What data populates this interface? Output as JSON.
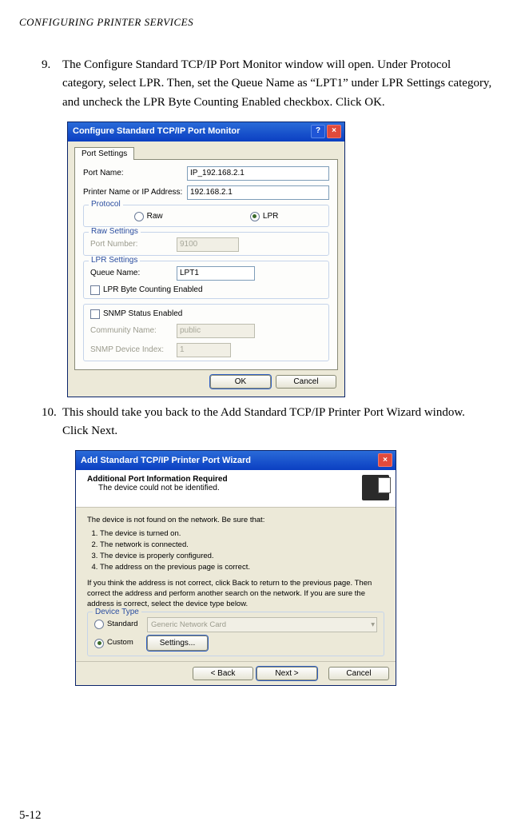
{
  "running_head": "CONFIGURING PRINTER SERVICES",
  "page_number": "5-12",
  "step9": {
    "num": "9.",
    "text": "The Configure Standard TCP/IP Port Monitor window will open. Under Protocol category, select LPR. Then, set the Queue Name as “LPT1” under LPR Settings category, and uncheck the LPR Byte Counting Enabled checkbox. Click OK."
  },
  "step10": {
    "num": "10.",
    "text": "This should take you back to the Add Standard TCP/IP Printer Port Wizard window. Click Next."
  },
  "dialog1": {
    "title": "Configure Standard TCP/IP Port Monitor",
    "help_symbol": "?",
    "close_symbol": "×",
    "tab": "Port Settings",
    "port_name_lbl": "Port Name:",
    "port_name_val": "IP_192.168.2.1",
    "ip_lbl": "Printer Name or IP Address:",
    "ip_val": "192.168.2.1",
    "protocol_group": "Protocol",
    "raw_label": "Raw",
    "lpr_label": "LPR",
    "raw_group": "Raw Settings",
    "port_number_lbl": "Port Number:",
    "port_number_val": "9100",
    "lpr_group": "LPR Settings",
    "queue_lbl": "Queue Name:",
    "queue_val": "LPT1",
    "lpr_byte_lbl": "LPR Byte Counting Enabled",
    "snmp_lbl": "SNMP Status Enabled",
    "community_lbl": "Community Name:",
    "community_val": "public",
    "snmp_index_lbl": "SNMP Device Index:",
    "snmp_index_val": "1",
    "ok": "OK",
    "cancel": "Cancel"
  },
  "dialog2": {
    "title": "Add Standard TCP/IP Printer Port Wizard",
    "close_symbol": "×",
    "head_title": "Additional Port Information Required",
    "head_sub": "The device could not be identified.",
    "intro": "The device is not found on the network.  Be sure that:",
    "li1": "The device is turned on.",
    "li2": "The network is connected.",
    "li3": "The device is properly configured.",
    "li4": "The address on the previous page is correct.",
    "para2": "If you think the address is not correct, click Back to return to the previous page. Then correct the address and perform another search on the network. If you are sure the address is correct, select the device type below.",
    "device_type_group": "Device Type",
    "standard_lbl": "Standard",
    "standard_sel": "Generic Network Card",
    "custom_lbl": "Custom",
    "settings_btn": "Settings...",
    "back": "< Back",
    "next": "Next >",
    "cancel": "Cancel"
  }
}
